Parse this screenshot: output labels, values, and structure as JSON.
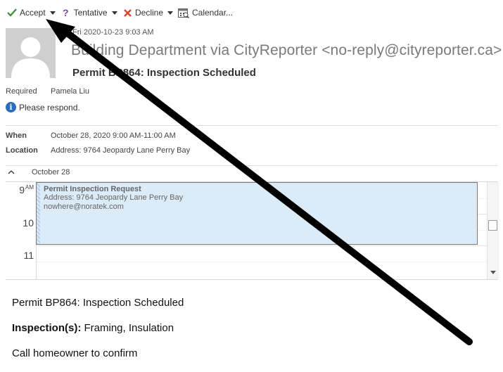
{
  "toolbar": {
    "accept_label": "Accept",
    "tentative_label": "Tentative",
    "decline_label": "Decline",
    "calendar_label": "Calendar..."
  },
  "message": {
    "date": "Fri 2020-10-23 9:03 AM",
    "sender": "Building Department via CityReporter <no-reply@cityreporter.ca>",
    "subject": "Permit BP864: Inspection Scheduled"
  },
  "attendees": {
    "required_label": "Required",
    "required_value": "Pamela Liu",
    "notice": "Please respond."
  },
  "details": {
    "when_label": "When",
    "when_value": "October 28, 2020 9:00 AM-11:00 AM",
    "location_label": "Location",
    "location_value": "Address: 9764 Jeopardy Lane Perry Bay"
  },
  "calendar": {
    "date_label": "October 28",
    "hours": [
      "9",
      "10",
      "11"
    ],
    "am_label": "AM",
    "event": {
      "title": "Permit Inspection Request",
      "address": "Address: 9764 Jeopardy Lane Perry Bay",
      "email": "nowhere@noratek.com"
    }
  },
  "body": {
    "line1": "Permit BP864: Inspection Scheduled",
    "inspection_label": "Inspection(s):",
    "inspection_value": " Framing, Insulation",
    "line3": "Call homeowner to confirm"
  },
  "colors": {
    "accept_check": "#3a8a3a",
    "tentative": "#7b3fa8",
    "decline": "#d9442a",
    "info": "#2a6db8",
    "event_fill": "#dcebf8",
    "annotation_arrow": "#000000"
  }
}
